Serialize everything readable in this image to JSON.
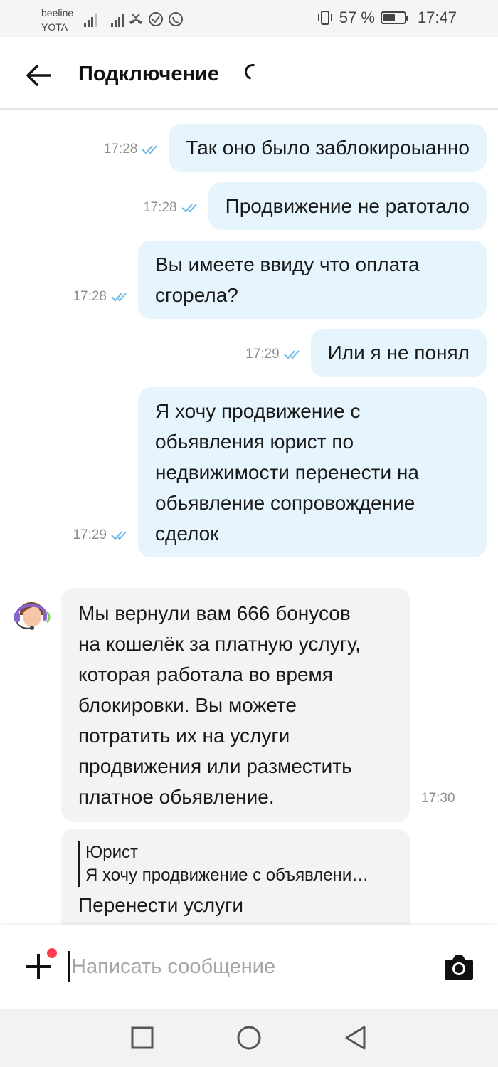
{
  "status_bar": {
    "carrier_1": "beeline",
    "carrier_2": "YOTA",
    "battery_text": "57 %",
    "battery_level": 0.57,
    "clock": "17:47",
    "icons": [
      "signal-icon",
      "signal-icon",
      "missed-call-icon",
      "check-circle-icon",
      "whatsapp-icon",
      "vibrate-icon",
      "battery-icon"
    ]
  },
  "header": {
    "title": "Подключение",
    "back_icon": "arrow-left-icon"
  },
  "messages_out": [
    {
      "time": "17:28",
      "lines": [
        "Так оно было заблокироыанно"
      ]
    },
    {
      "time": "17:28",
      "lines": [
        "Продвижение не ратотало"
      ]
    },
    {
      "time": "17:28",
      "lines": [
        "Вы имеете ввиду что оплата",
        "сгорела?"
      ]
    },
    {
      "time": "17:29",
      "lines": [
        "Или я не понял"
      ]
    },
    {
      "time": "17:29",
      "lines": [
        "Я хочу продвижение с",
        "обьявления юрист по",
        "недвижимости перенести на",
        "обьявление сопровождение",
        "сделок"
      ]
    }
  ],
  "message_in": {
    "time": "17:30",
    "lines": [
      "Мы вернули вам 666 бонусов",
      "на кошелёк за платную услугу,",
      "которая работала во время",
      "блокировки. Вы можете",
      "потратить их на услуги",
      "продвижения или разместить",
      "платное обьявление."
    ]
  },
  "reply_message": {
    "quote_name": "Юрист",
    "quote_text": "Я хочу продвижение с объявлени…",
    "text": "Перенести услуги"
  },
  "composer": {
    "placeholder": "Написать сообщение",
    "value": ""
  },
  "colors": {
    "outgoing_bubble": "#e5f4fd",
    "incoming_bubble": "#f3f3f3",
    "read_ticks": "#6ab8e8",
    "notification_dot": "#ff3b4e"
  }
}
